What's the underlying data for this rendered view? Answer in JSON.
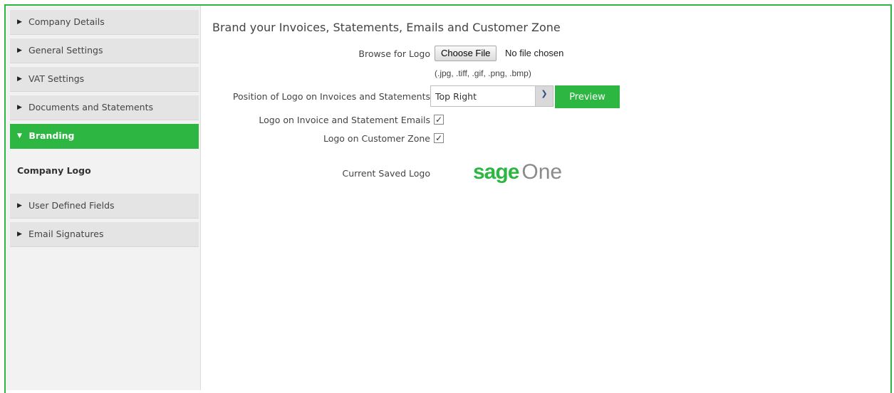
{
  "sidebar": {
    "items": [
      {
        "label": "Company Details"
      },
      {
        "label": "General Settings"
      },
      {
        "label": "VAT Settings"
      },
      {
        "label": "Documents and Statements"
      },
      {
        "label": "Branding"
      },
      {
        "label": "User Defined Fields"
      },
      {
        "label": "Email Signatures"
      }
    ],
    "sub_item": "Company Logo",
    "active_item": "Branding"
  },
  "main": {
    "title": "Brand your Invoices, Statements, Emails and Customer Zone",
    "browse_label": "Browse for Logo",
    "choose_file_label": "Choose File",
    "no_file_text": "No file chosen",
    "file_types_hint": "(.jpg, .tiff, .gif, .png, .bmp)",
    "position_label": "Position of Logo on Invoices and Statements",
    "position_value": "Top Right",
    "preview_label": "Preview",
    "emails_label": "Logo on Invoice and Statement Emails",
    "emails_checked": true,
    "customer_zone_label": "Logo on Customer Zone",
    "customer_zone_checked": true,
    "current_logo_label": "Current Saved Logo",
    "logo_text_1": "sage",
    "logo_text_2": "One"
  },
  "colors": {
    "accent": "#2db742",
    "logo_grey": "#8a8a8a"
  }
}
